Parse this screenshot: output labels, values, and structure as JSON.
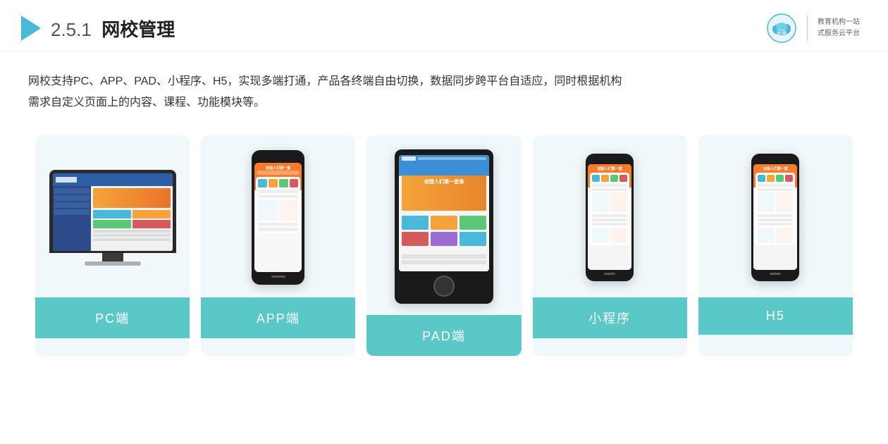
{
  "header": {
    "section_number": "2.5.1",
    "title": "网校管理",
    "brand": {
      "name": "云朵课堂",
      "url": "yunduoketang.com",
      "slogan_line1": "教育机构一站",
      "slogan_line2": "式服务云平台"
    }
  },
  "description": {
    "line1": "网校支持PC、APP、PAD、小程序、H5，实现多端打通，产品各终端自由切换，数据同步跨平台自适应，同时根据机构",
    "line2": "需求自定义页面上的内容、课程、功能模块等。"
  },
  "cards": [
    {
      "id": "pc",
      "label": "PC端"
    },
    {
      "id": "app",
      "label": "APP端"
    },
    {
      "id": "pad",
      "label": "PAD端"
    },
    {
      "id": "miniprogram",
      "label": "小程序"
    },
    {
      "id": "h5",
      "label": "H5"
    }
  ],
  "colors": {
    "accent": "#5bc8c8",
    "accent_dark": "#4ab8d8",
    "triangle": "#4ab8d8",
    "brand_blue": "#1a8fcc"
  }
}
